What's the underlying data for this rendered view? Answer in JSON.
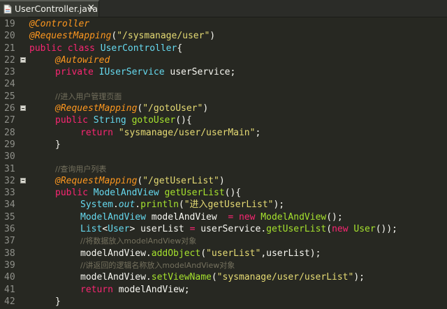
{
  "tab": {
    "title": "UserController.java",
    "close": "✕",
    "icon": "java-file-icon"
  },
  "colors": {
    "background": "#272822",
    "annotation": "#fd971f",
    "keyword": "#f92672",
    "type": "#66d9ef",
    "string": "#e6db74",
    "function": "#a6e22e",
    "comment": "#75715e",
    "plain": "#f8f8f2",
    "line_number": "#8f908a"
  },
  "lines": [
    {
      "n": "19",
      "fold": false,
      "indent": 0,
      "tokens": [
        {
          "t": "@Controller",
          "c": "ann"
        }
      ]
    },
    {
      "n": "20",
      "fold": false,
      "indent": 0,
      "tokens": [
        {
          "t": "@RequestMapping",
          "c": "ann"
        },
        {
          "t": "(",
          "c": "plain"
        },
        {
          "t": "\"/sysmanage/user\"",
          "c": "str"
        },
        {
          "t": ")",
          "c": "plain"
        }
      ]
    },
    {
      "n": "21",
      "fold": false,
      "indent": 0,
      "tokens": [
        {
          "t": "public ",
          "c": "kw"
        },
        {
          "t": "class ",
          "c": "kw"
        },
        {
          "t": "UserController",
          "c": "type"
        },
        {
          "t": "{",
          "c": "plain"
        }
      ]
    },
    {
      "n": "22",
      "fold": true,
      "indent": 1,
      "tokens": [
        {
          "t": "@Autowired",
          "c": "ann"
        }
      ]
    },
    {
      "n": "23",
      "fold": false,
      "indent": 1,
      "tokens": [
        {
          "t": "private ",
          "c": "kw"
        },
        {
          "t": "IUserService ",
          "c": "type"
        },
        {
          "t": "userService",
          "c": "plain"
        },
        {
          "t": ";",
          "c": "plain"
        }
      ]
    },
    {
      "n": "24",
      "fold": false,
      "indent": 0,
      "tokens": []
    },
    {
      "n": "25",
      "fold": false,
      "indent": 1,
      "tokens": [
        {
          "t": "//进入用户管理页面",
          "c": "com"
        }
      ]
    },
    {
      "n": "26",
      "fold": true,
      "indent": 1,
      "tokens": [
        {
          "t": "@RequestMapping",
          "c": "ann"
        },
        {
          "t": "(",
          "c": "plain"
        },
        {
          "t": "\"/gotoUser\"",
          "c": "str"
        },
        {
          "t": ")",
          "c": "plain"
        }
      ]
    },
    {
      "n": "27",
      "fold": false,
      "indent": 1,
      "tokens": [
        {
          "t": "public ",
          "c": "kw"
        },
        {
          "t": "String ",
          "c": "type"
        },
        {
          "t": "gotoUser",
          "c": "fn"
        },
        {
          "t": "(){",
          "c": "plain"
        }
      ]
    },
    {
      "n": "28",
      "fold": false,
      "indent": 2,
      "tokens": [
        {
          "t": "return ",
          "c": "kw"
        },
        {
          "t": "\"sysmanage/user/userMain\"",
          "c": "str"
        },
        {
          "t": ";",
          "c": "plain"
        }
      ]
    },
    {
      "n": "29",
      "fold": false,
      "indent": 1,
      "tokens": [
        {
          "t": "}",
          "c": "plain"
        }
      ]
    },
    {
      "n": "30",
      "fold": false,
      "indent": 0,
      "tokens": []
    },
    {
      "n": "31",
      "fold": false,
      "indent": 1,
      "tokens": [
        {
          "t": "//查询用户列表",
          "c": "com"
        }
      ]
    },
    {
      "n": "32",
      "fold": true,
      "indent": 1,
      "tokens": [
        {
          "t": "@RequestMapping",
          "c": "ann"
        },
        {
          "t": "(",
          "c": "plain"
        },
        {
          "t": "\"/getUserList\"",
          "c": "str"
        },
        {
          "t": ")",
          "c": "plain"
        }
      ]
    },
    {
      "n": "33",
      "fold": false,
      "indent": 1,
      "tokens": [
        {
          "t": "public ",
          "c": "kw"
        },
        {
          "t": "ModelAndView ",
          "c": "type"
        },
        {
          "t": "getUserList",
          "c": "fn"
        },
        {
          "t": "(){",
          "c": "plain"
        }
      ]
    },
    {
      "n": "34",
      "fold": false,
      "indent": 2,
      "tokens": [
        {
          "t": "System",
          "c": "type"
        },
        {
          "t": ".",
          "c": "plain"
        },
        {
          "t": "out",
          "c": "field"
        },
        {
          "t": ".",
          "c": "plain"
        },
        {
          "t": "println",
          "c": "fn"
        },
        {
          "t": "(",
          "c": "plain"
        },
        {
          "t": "\"进入getUserList\"",
          "c": "str"
        },
        {
          "t": ");",
          "c": "plain"
        }
      ]
    },
    {
      "n": "35",
      "fold": false,
      "indent": 2,
      "tokens": [
        {
          "t": "ModelAndView ",
          "c": "type"
        },
        {
          "t": "modelAndView  ",
          "c": "plain"
        },
        {
          "t": "= ",
          "c": "kw"
        },
        {
          "t": "new ",
          "c": "kw"
        },
        {
          "t": "ModelAndView",
          "c": "fn"
        },
        {
          "t": "();",
          "c": "plain"
        }
      ]
    },
    {
      "n": "36",
      "fold": false,
      "indent": 2,
      "tokens": [
        {
          "t": "List",
          "c": "type"
        },
        {
          "t": "<",
          "c": "plain"
        },
        {
          "t": "User",
          "c": "type"
        },
        {
          "t": "> ",
          "c": "plain"
        },
        {
          "t": "userList ",
          "c": "plain"
        },
        {
          "t": "= ",
          "c": "kw"
        },
        {
          "t": "userService",
          "c": "plain"
        },
        {
          "t": ".",
          "c": "plain"
        },
        {
          "t": "getUserList",
          "c": "fn"
        },
        {
          "t": "(",
          "c": "plain"
        },
        {
          "t": "new ",
          "c": "kw"
        },
        {
          "t": "User",
          "c": "fn"
        },
        {
          "t": "());",
          "c": "plain"
        }
      ]
    },
    {
      "n": "37",
      "fold": false,
      "indent": 2,
      "tokens": [
        {
          "t": "//将数据放入modelAndView对象",
          "c": "com"
        }
      ]
    },
    {
      "n": "38",
      "fold": false,
      "indent": 2,
      "tokens": [
        {
          "t": "modelAndView",
          "c": "plain"
        },
        {
          "t": ".",
          "c": "plain"
        },
        {
          "t": "addObject",
          "c": "fn"
        },
        {
          "t": "(",
          "c": "plain"
        },
        {
          "t": "\"userList\"",
          "c": "str"
        },
        {
          "t": ",",
          "c": "plain"
        },
        {
          "t": "userList",
          "c": "plain"
        },
        {
          "t": ");",
          "c": "plain"
        }
      ]
    },
    {
      "n": "39",
      "fold": false,
      "indent": 2,
      "tokens": [
        {
          "t": "//讲返回的逻辑名称放入modelAndView对象",
          "c": "com"
        }
      ]
    },
    {
      "n": "40",
      "fold": false,
      "indent": 2,
      "tokens": [
        {
          "t": "modelAndView",
          "c": "plain"
        },
        {
          "t": ".",
          "c": "plain"
        },
        {
          "t": "setViewName",
          "c": "fn"
        },
        {
          "t": "(",
          "c": "plain"
        },
        {
          "t": "\"sysmanage/user/userList\"",
          "c": "str"
        },
        {
          "t": ");",
          "c": "plain"
        }
      ]
    },
    {
      "n": "41",
      "fold": false,
      "indent": 2,
      "tokens": [
        {
          "t": "return ",
          "c": "kw"
        },
        {
          "t": "modelAndView",
          "c": "plain"
        },
        {
          "t": ";",
          "c": "plain"
        }
      ]
    },
    {
      "n": "42",
      "fold": false,
      "indent": 1,
      "tokens": [
        {
          "t": "}",
          "c": "plain"
        }
      ]
    }
  ]
}
